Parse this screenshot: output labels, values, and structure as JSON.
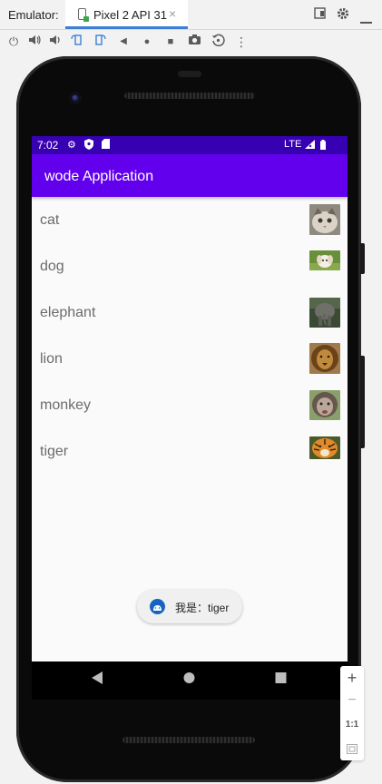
{
  "tool_window": {
    "title": "Emulator:",
    "tab_label": "Pixel 2 API 31",
    "tab_close": "×"
  },
  "toolbar_icons": [
    "power-icon",
    "volume-up-icon",
    "volume-down-icon",
    "rotate-left-icon",
    "rotate-right-icon",
    "back-icon",
    "home-icon",
    "overview-icon",
    "screenshot-icon",
    "snapshot-icon",
    "more-icon"
  ],
  "status_bar": {
    "time": "7:02",
    "network": "LTE"
  },
  "app_bar": {
    "title": "wode Application"
  },
  "animals": [
    {
      "label": "cat",
      "thumb_colors": [
        "#d9d3c8",
        "#6e6558"
      ]
    },
    {
      "label": "dog",
      "thumb_colors": [
        "#f3efe4",
        "#6a8f3a"
      ]
    },
    {
      "label": "elephant",
      "thumb_colors": [
        "#6f7068",
        "#3b4a35"
      ]
    },
    {
      "label": "lion",
      "thumb_colors": [
        "#c08a3e",
        "#6a4418"
      ]
    },
    {
      "label": "monkey",
      "thumb_colors": [
        "#b9a79a",
        "#66574d"
      ]
    },
    {
      "label": "tiger",
      "thumb_colors": [
        "#e08a2a",
        "#3a2a12"
      ]
    }
  ],
  "toast": {
    "text": "我是：tiger"
  },
  "zoom_controls": {
    "zoom_in": "+",
    "zoom_out": "−",
    "actual_size": "1:1"
  },
  "colors": {
    "status_bar": "#3700b3",
    "app_bar": "#6200ee",
    "tab_accent": "#3d7fd6"
  }
}
